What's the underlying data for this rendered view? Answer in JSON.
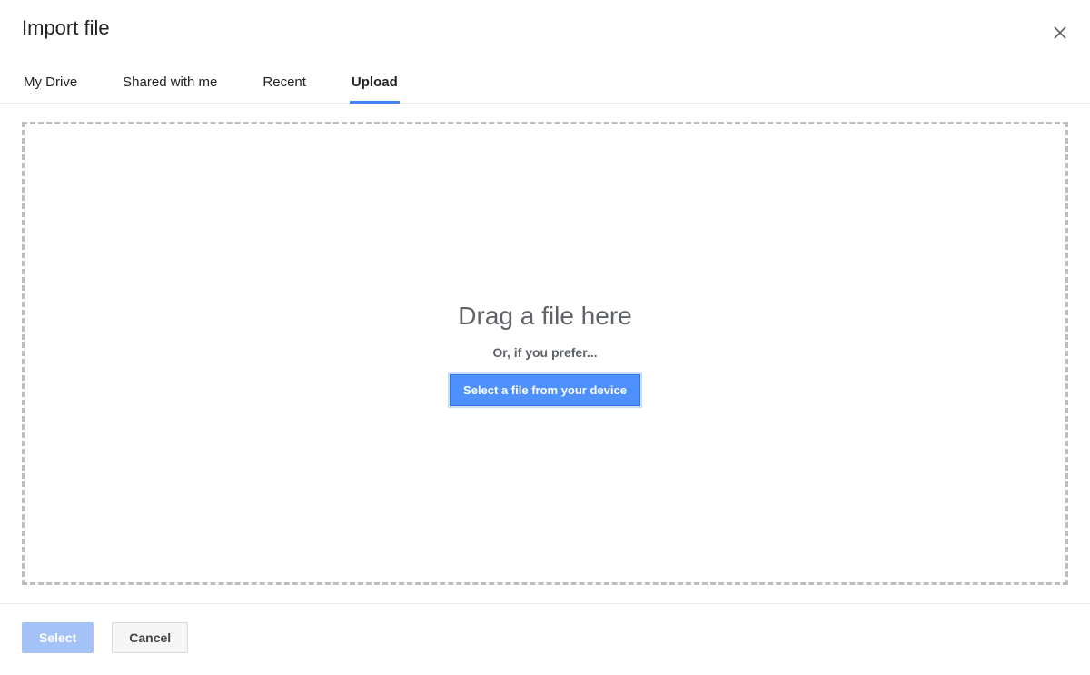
{
  "dialog": {
    "title": "Import file"
  },
  "tabs": [
    {
      "label": "My Drive",
      "active": false
    },
    {
      "label": "Shared with me",
      "active": false
    },
    {
      "label": "Recent",
      "active": false
    },
    {
      "label": "Upload",
      "active": true
    }
  ],
  "dropzone": {
    "headline": "Drag a file here",
    "subtext": "Or, if you prefer...",
    "button_label": "Select a file from your device"
  },
  "footer": {
    "primary_label": "Select",
    "secondary_label": "Cancel"
  }
}
